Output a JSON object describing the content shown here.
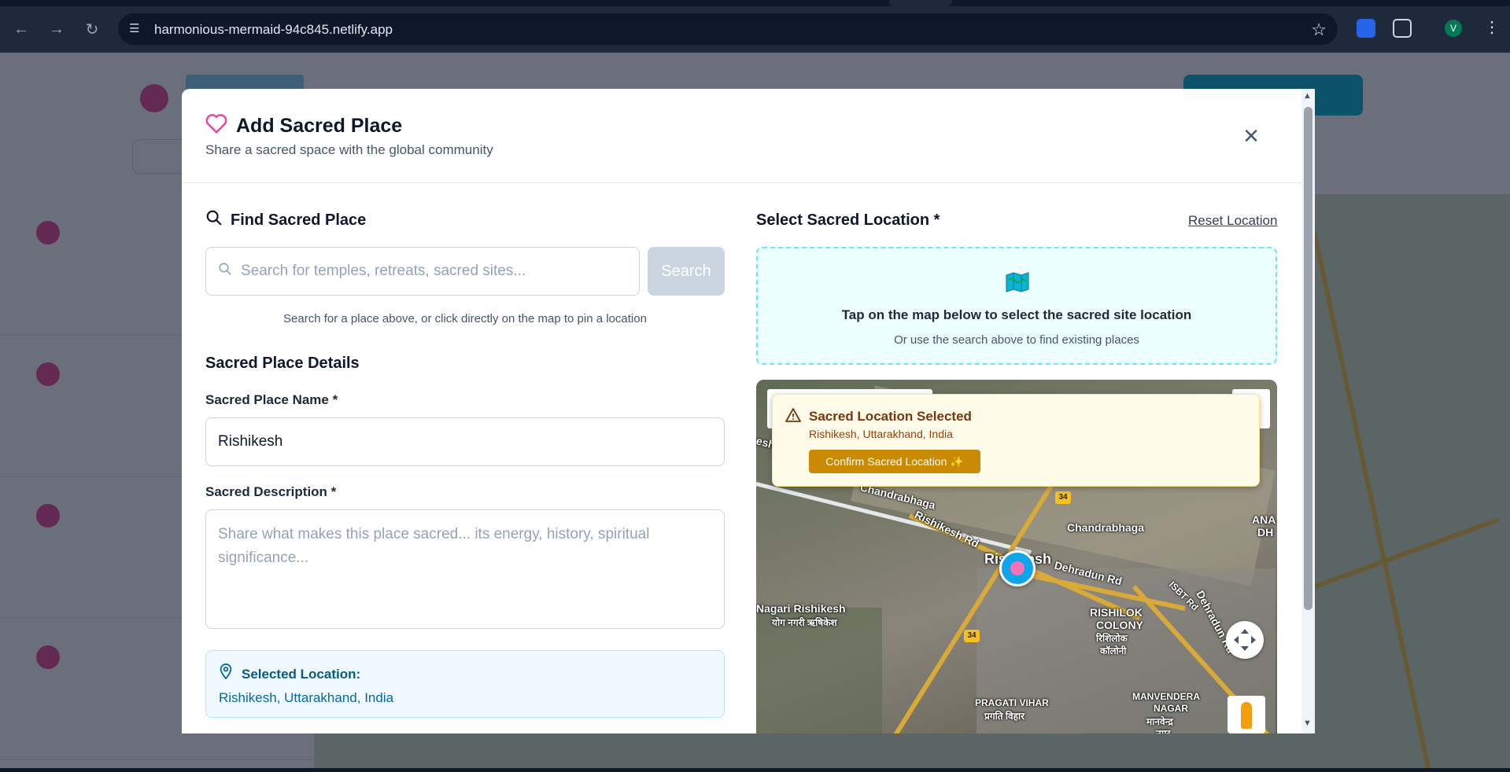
{
  "browser": {
    "url": "harmonious-mermaid-94c845.netlify.app",
    "profile_initial": "V",
    "icons": [
      "back-arrow-icon",
      "forward-arrow-icon",
      "reload-icon",
      "site-info-icon",
      "bookmark-star-icon",
      "extension-icon",
      "puzzle-icon",
      "more-vert-icon"
    ]
  },
  "modal": {
    "title": "Add Sacred Place",
    "subtitle": "Share a sacred space with the global community",
    "close_label": "×"
  },
  "find": {
    "title": "Find Sacred Place",
    "placeholder": "Search for temples, retreats, sacred sites...",
    "button": "Search",
    "hint": "Search for a place above, or click directly on the map to pin a location"
  },
  "details": {
    "title": "Sacred Place Details",
    "name_label": "Sacred Place Name *",
    "name_value": "Rishikesh",
    "desc_label": "Sacred Description *",
    "desc_placeholder": "Share what makes this place sacred... its energy, history, spiritual significance...",
    "selected_label": "Selected Location:",
    "selected_value": "Rishikesh, Uttarakhand, India"
  },
  "location": {
    "title": "Select Sacred Location *",
    "reset": "Reset Location",
    "tap_main": "Tap on the map below to select the sacred site location",
    "tap_sub": "Or use the search above to find existing places"
  },
  "alert": {
    "title": "Sacred Location Selected",
    "subtitle": "Rishikesh, Uttarakhand, India",
    "button": "Confirm Sacred Location ✨"
  },
  "map": {
    "labels": {
      "chandrabhaga_1": "Chandrabhaga",
      "chandrabhaga_2": "Chandrabhaga",
      "rishikesh_rd": "Rishikesh Rd",
      "city": "Rishikesh",
      "dehradun_rd_1": "Dehradun Rd",
      "dehradun_rd_2": "Dehradun Rd",
      "isbt_rd": "ISBT Rd",
      "nagari": "Nagari Rishikesh",
      "nagari_hi": "योग नगरी ऋषिकेश",
      "rishilok_1": "RISHILOK",
      "rishilok_2": "COLONY",
      "rishilok_hi_1": "रिशिलोक",
      "rishilok_hi_2": "कॉलोनी",
      "pragati": "PRAGATI VIHAR",
      "pragati_hi": "प्रगति विहार",
      "manvendera_1": "MANVENDERA",
      "manvendera_2": "NAGAR",
      "manvendera_hi_1": "मानवेन्द्र",
      "manvendera_hi_2": "नगर",
      "edge_left": "esh",
      "edge_right_1": "ANA",
      "edge_right_2": "DH",
      "route": "34",
      "route_2": "34"
    }
  },
  "colors": {
    "accent_cyan": "#06b6d4",
    "heart_pink": "#ec4899",
    "alert_button": "#ca8a04"
  }
}
